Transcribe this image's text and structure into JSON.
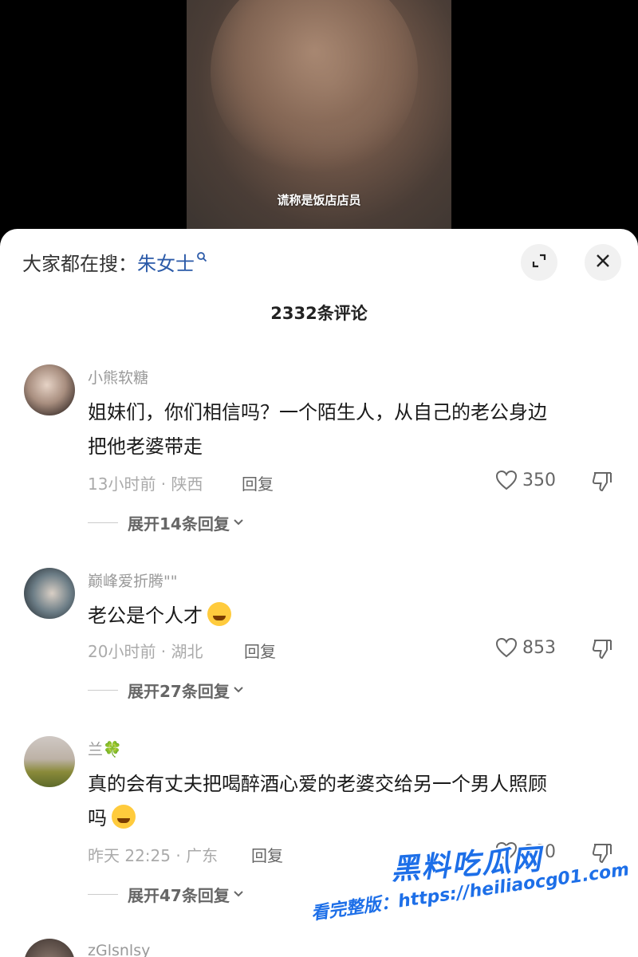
{
  "video": {
    "caption": "谎称是饭店店员"
  },
  "header": {
    "search_prefix": "大家都在搜：",
    "search_term": "朱女士",
    "comment_count": "2332条评论"
  },
  "comments": [
    {
      "username": "小熊软糖",
      "text_line1": "姐妹们，你们相信吗？一个陌生人，从自己的老公身边",
      "text_line2": "把他老婆带走",
      "meta": "13小时前 · 陕西",
      "reply": "回复",
      "likes": "350",
      "expand": "展开14条回复"
    },
    {
      "username": "巅峰爱折腾\"\"",
      "text_line1": "老公是个人才",
      "emoji": "crying-laughing-emoji",
      "meta": "20小时前 · 湖北",
      "reply": "回复",
      "likes": "853",
      "expand": "展开27条回复"
    },
    {
      "username": "兰🍀",
      "text_line1": "真的会有丈夫把喝醉酒心爱的老婆交给另一个男人照顾",
      "text_line2": "吗",
      "emoji": "sweat-smile-emoji",
      "meta": "昨天 22:25 · 广东",
      "reply": "回复",
      "likes": "660",
      "expand": "展开47条回复"
    },
    {
      "username": "zGlsnlsy"
    }
  ],
  "watermark": {
    "brand": "黑料吃瓜网",
    "site": "看完整版：https://heiliaocg01.com"
  },
  "colors": {
    "link_blue": "#2b5aa8",
    "watermark_blue": "#1d6fe8"
  }
}
